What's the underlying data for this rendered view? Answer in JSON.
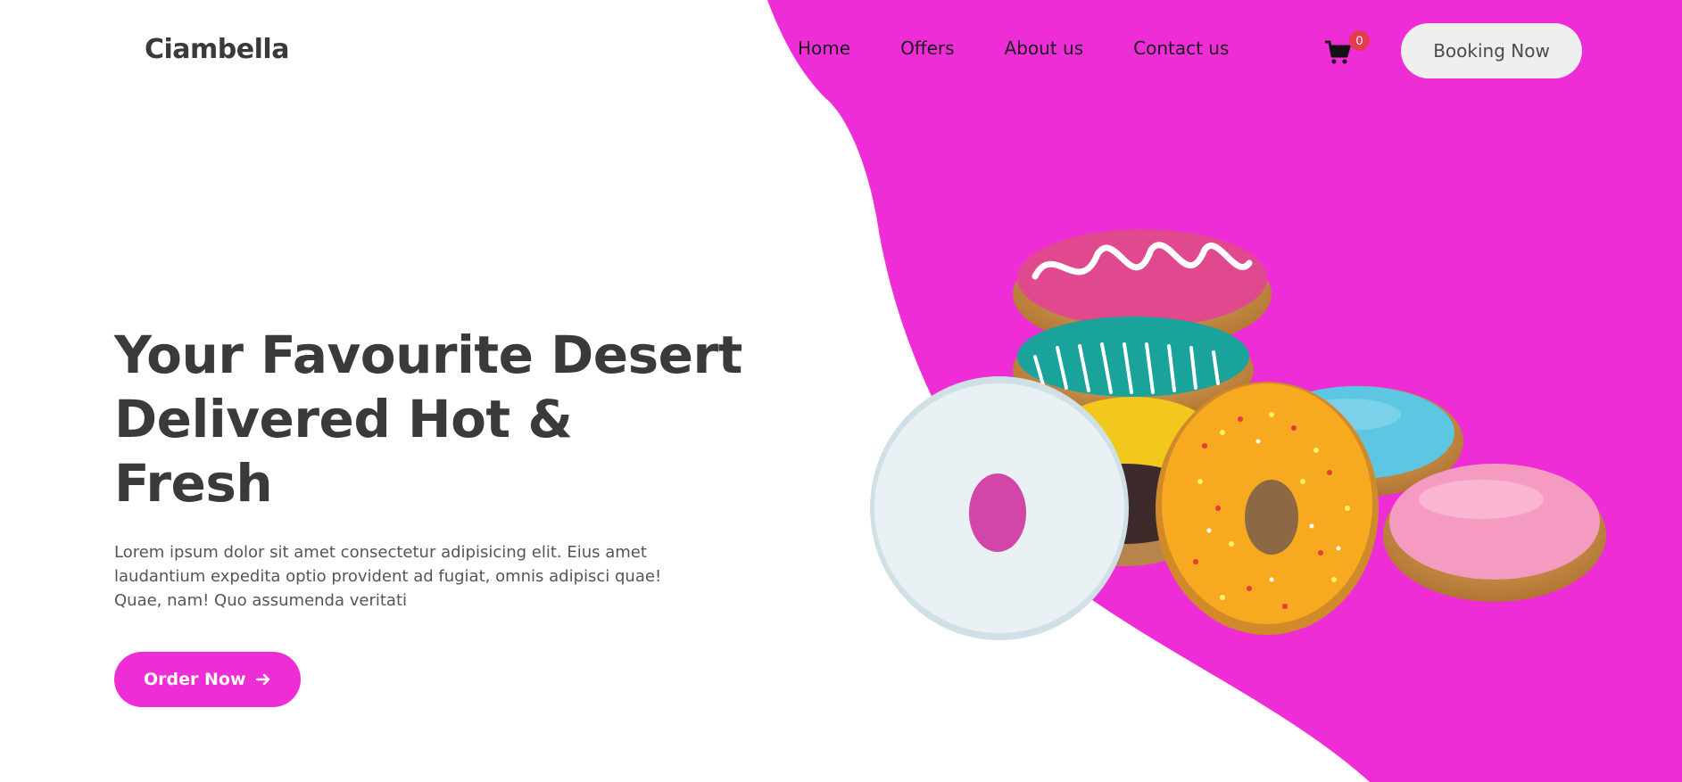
{
  "brand": {
    "logo_text": "Ciambella",
    "accent_color": "#ee2dd6",
    "badge_color": "#e53b4e"
  },
  "nav": {
    "items": [
      {
        "label": "Home"
      },
      {
        "label": "Offers"
      },
      {
        "label": "About us"
      },
      {
        "label": "Contact us"
      }
    ]
  },
  "cart": {
    "icon": "cart-icon",
    "count": "0"
  },
  "header": {
    "booking_label": "Booking Now"
  },
  "hero": {
    "title_line1": "Your Favourite Desert",
    "title_line2": "Delivered Hot &",
    "title_line3": "Fresh",
    "description": "Lorem ipsum dolor sit amet consectetur adipisicing elit. Eius amet laudantium expedita optio provident ad fugiat, omnis adipisci quae! Quae, nam! Quo assumenda veritati",
    "order_label": "Order Now",
    "order_icon": "arrow-right-icon"
  }
}
